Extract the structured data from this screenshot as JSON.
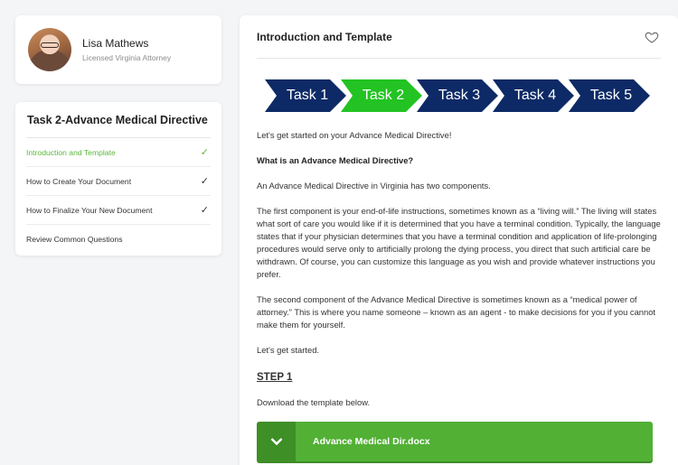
{
  "profile": {
    "name": "Lisa Mathews",
    "subtitle": "Licensed Virginia Attorney"
  },
  "task_panel": {
    "title": "Task 2-Advance Medical Directive",
    "items": [
      {
        "label": "Introduction and Template",
        "checked": true,
        "active": true
      },
      {
        "label": "How to Create Your Document",
        "checked": true,
        "active": false
      },
      {
        "label": "How to Finalize Your New Document",
        "checked": true,
        "active": false
      },
      {
        "label": "Review Common Questions",
        "checked": false,
        "active": false
      }
    ]
  },
  "main": {
    "title": "Introduction and Template",
    "favorite_icon": "heart-outline-icon",
    "steps": [
      "Task 1",
      "Task 2",
      "Task 3",
      "Task 4",
      "Task 5"
    ],
    "active_step": "Task 2",
    "colors": {
      "step": "#0d2a66",
      "active_step": "#22c322",
      "accent": "#5cb73b",
      "download": "#52b035"
    },
    "paragraphs": {
      "intro": "Let's get started on your Advance Medical Directive!",
      "question": "What is an Advance Medical Directive?",
      "components": "An Advance Medical Directive in Virginia has two components.",
      "first": "The first component is your end-of-life instructions, sometimes known as a “living will.” The living will states what sort of care you would like if it is determined that you have a terminal condition. Typically, the language states that if your physician determines that you have a terminal condition and application of life-prolonging procedures would serve only to artificially prolong the dying process, you direct that such artificial care be withdrawn. Of course, you can customize this language as you wish and provide whatever instructions you prefer.",
      "second": "The second component of the Advance Medical Directive is sometimes known as a “medical power of attorney.” This is where you name someone – known as an agent - to make decisions for you if you cannot make them for yourself.",
      "start": "Let's get started.",
      "step_heading": "STEP 1",
      "download_intro": "Download the template below."
    },
    "download": {
      "label": "Advance Medical Dir.docx",
      "icon": "chevron-down-icon"
    }
  }
}
